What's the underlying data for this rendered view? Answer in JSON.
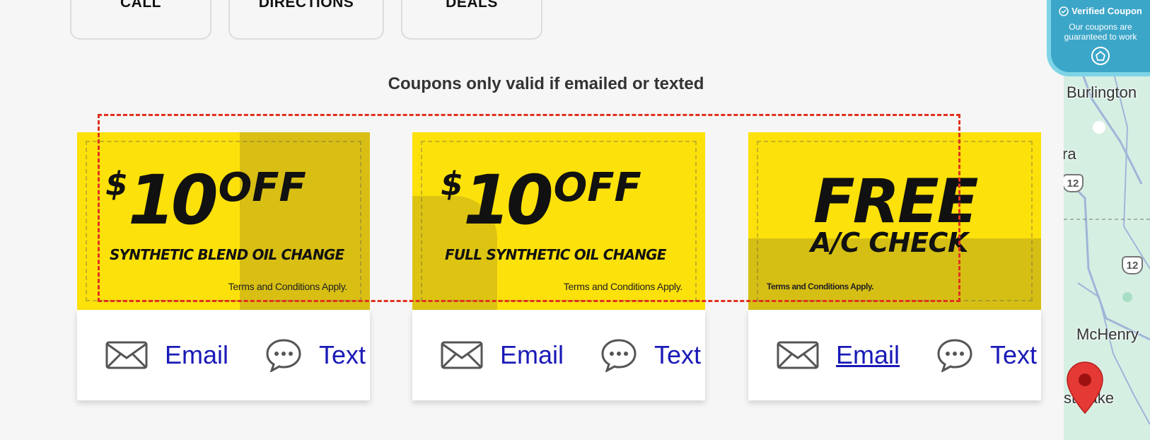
{
  "top_buttons": [
    {
      "label": "CALL"
    },
    {
      "label": "DIRECTIONS"
    },
    {
      "label": "DEALS"
    }
  ],
  "notice": "Coupons only valid if emailed or texted",
  "coupons": [
    {
      "dollar": "$",
      "amount": "10",
      "off": "OFF",
      "service": "SYNTHETIC BLEND OIL CHANGE",
      "terms": "Terms and Conditions Apply.",
      "email_label": "Email",
      "text_label": "Text"
    },
    {
      "dollar": "$",
      "amount": "10",
      "off": "OFF",
      "service": "FULL SYNTHETIC OIL CHANGE",
      "terms": "Terms and Conditions Apply.",
      "email_label": "Email",
      "text_label": "Text"
    },
    {
      "title": "FREE",
      "subtitle": "A/C CHECK",
      "terms": "Terms and Conditions Apply.",
      "email_label": "Email",
      "text_label": "Text"
    }
  ],
  "verified": {
    "title": "Verified Coupon",
    "subtitle": "Our coupons are guaranteed to work"
  },
  "map": {
    "labels": [
      "Burlington",
      "ra",
      "McHenry",
      "st Lake"
    ],
    "route_shields": [
      "12",
      "12"
    ]
  },
  "colors": {
    "coupon_yellow": "#fde10a",
    "link_blue": "#1a1ab8",
    "dashed_red": "#e0321f",
    "verified_bg": "#3ca6c8",
    "map_pin": "#e53935"
  }
}
